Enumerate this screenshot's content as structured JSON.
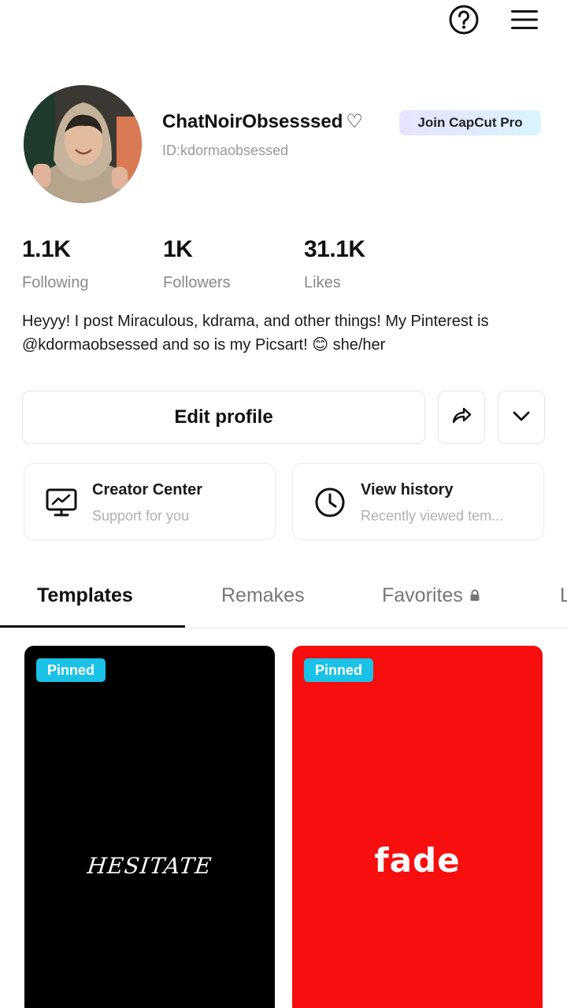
{
  "header": {
    "help_icon": "help-circle-icon",
    "menu_icon": "hamburger-menu-icon"
  },
  "profile": {
    "username": "ChatNoirObsesssed",
    "username_suffix": "♡",
    "user_id": "ID:kdormaobsessed",
    "pro_label": "Join CapCut Pro"
  },
  "stats": {
    "following": {
      "value": "1.1K",
      "label": "Following"
    },
    "followers": {
      "value": "1K",
      "label": "Followers"
    },
    "likes": {
      "value": "31.1K",
      "label": "Likes"
    }
  },
  "bio": "Heyyy! I post Miraculous, kdrama, and other things! My Pinterest is @kdormaobsessed and so is my Picsart! 😊 she/her",
  "actions": {
    "edit_label": "Edit profile",
    "share_icon": "share-arrow-icon",
    "more_icon": "chevron-down-icon"
  },
  "cards": [
    {
      "title": "Creator Center",
      "subtitle": "Support for you",
      "icon": "monitor-chart-icon"
    },
    {
      "title": "View history",
      "subtitle": "Recently viewed tem...",
      "icon": "clock-icon"
    }
  ],
  "tabs": [
    {
      "label": "Templates",
      "active": true
    },
    {
      "label": "Remakes"
    },
    {
      "label": "Favorites",
      "icon": "lock-icon"
    },
    {
      "label": "L"
    }
  ],
  "templates": [
    {
      "badge": "Pinned",
      "text": "HESITATE",
      "background": "#000000"
    },
    {
      "badge": "Pinned",
      "text": "fade",
      "background": "#f70e0e"
    }
  ],
  "colors": {
    "accent_cyan": "#19c2e6",
    "secondary_text": "#8a8a8a",
    "red_tile": "#f70e0e"
  }
}
